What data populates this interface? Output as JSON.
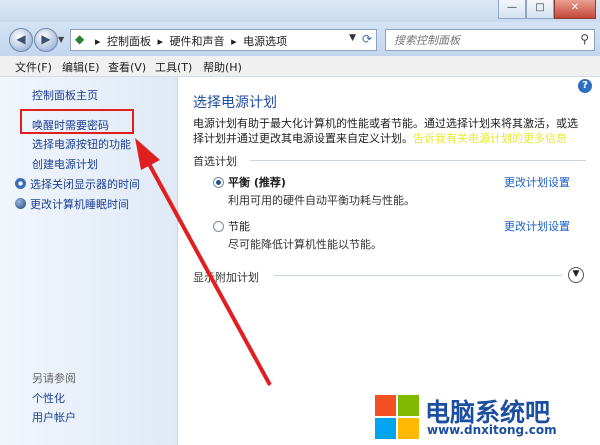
{
  "window": {
    "min": "—",
    "max": "□",
    "close": "✕"
  },
  "address": {
    "crumbs": [
      "▸",
      "控制面板",
      "▸",
      "硬件和声音",
      "▸",
      "电源选项"
    ],
    "dropdown": "▼",
    "search_placeholder": "搜索控制面板"
  },
  "menu": [
    "文件(F)",
    "编辑(E)",
    "查看(V)",
    "工具(T)",
    "帮助(H)"
  ],
  "sidebar": {
    "home": "控制面板主页",
    "items": [
      "唤醒时需要密码",
      "选择电源按钮的功能",
      "创建电源计划",
      "选择关闭显示器的时间",
      "更改计算机睡眠时间"
    ],
    "see_also_title": "另请参阅",
    "see_also": [
      "个性化",
      "用户帐户"
    ]
  },
  "content": {
    "title": "选择电源计划",
    "desc": "电源计划有助于最大化计算机的性能或者节能。通过选择计划来将其激活，或选择计划并通过更改其电源设置来自定义计划。",
    "desc_link": "告诉我有关电源计划的更多信息",
    "preferred_label": "首选计划",
    "plans": [
      {
        "name": "平衡 (推荐)",
        "desc": "利用可用的硬件自动平衡功耗与性能。",
        "link": "更改计划设置",
        "selected": true
      },
      {
        "name": "节能",
        "desc": "尽可能降低计算机性能以节能。",
        "link": "更改计划设置",
        "selected": false
      }
    ],
    "show_more": "显示附加计划"
  },
  "watermark": {
    "text": "电脑系统吧",
    "url": "www.dnxitong.com",
    "colors": [
      "#f25022",
      "#7fba00",
      "#00a4ef",
      "#ffb900"
    ]
  },
  "annotation": {
    "color": "#e02020"
  }
}
